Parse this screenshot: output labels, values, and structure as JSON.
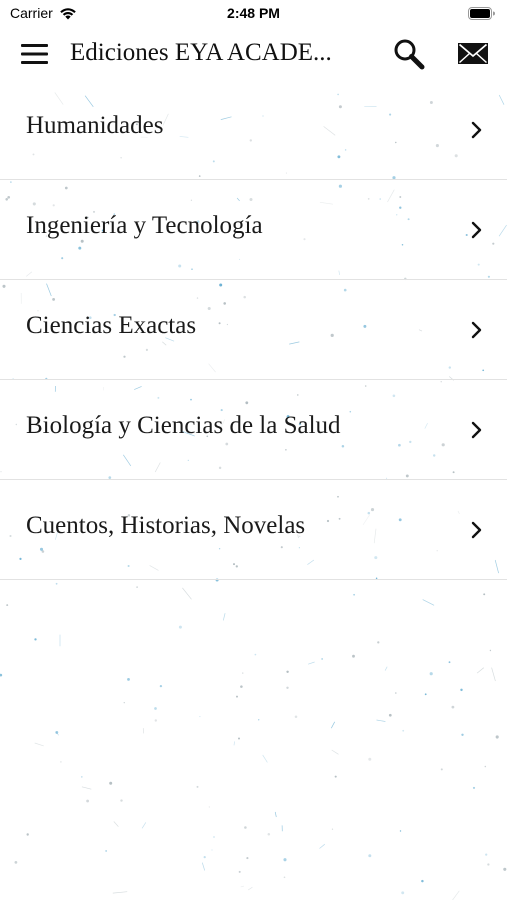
{
  "status_bar": {
    "carrier": "Carrier",
    "time": "2:48 PM",
    "icons": [
      "wifi-icon",
      "battery-icon"
    ]
  },
  "nav_bar": {
    "title": "Ediciones EYA ACADE...",
    "icons": [
      "menu-icon",
      "search-icon",
      "mail-icon"
    ]
  },
  "categories": [
    {
      "label": "Humanidades",
      "icon": "chevron-right-icon"
    },
    {
      "label": "Ingeniería y Tecnología",
      "icon": "chevron-right-icon"
    },
    {
      "label": "Ciencias Exactas",
      "icon": "chevron-right-icon"
    },
    {
      "label": "Biología y Ciencias de la Salud",
      "icon": "chevron-right-icon"
    },
    {
      "label": "Cuentos, Historias, Novelas",
      "icon": "chevron-right-icon"
    }
  ],
  "colors": {
    "background": "#ffffff",
    "text": "#111111",
    "separator": "#e2e2e2",
    "speckle": "#4a9fc9"
  }
}
